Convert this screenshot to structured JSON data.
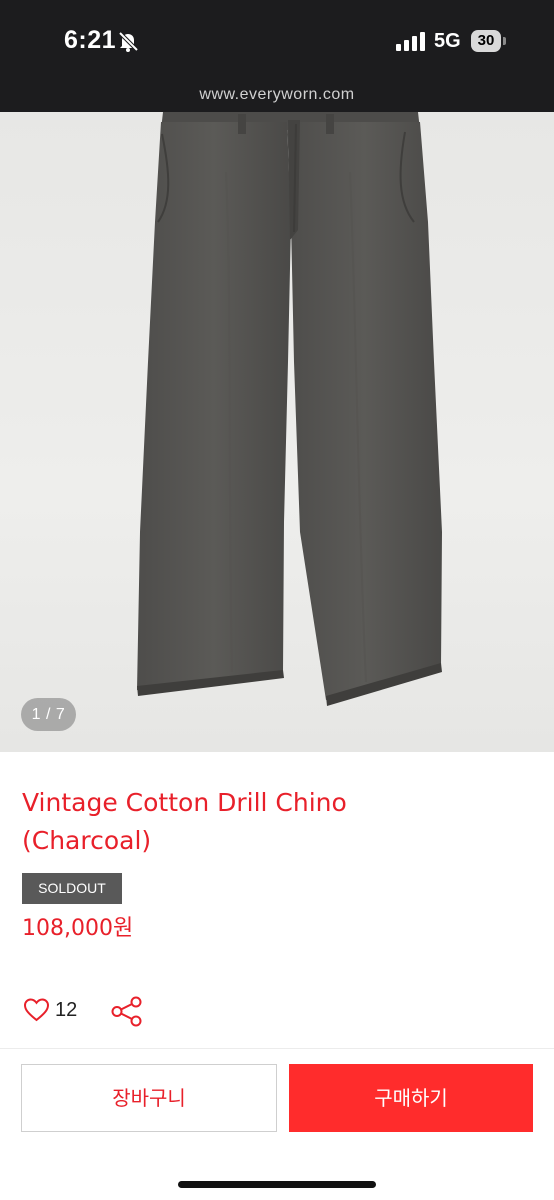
{
  "status_bar": {
    "time": "6:21",
    "network": "5G",
    "battery": "30"
  },
  "browser": {
    "url": "www.everyworn.com"
  },
  "gallery": {
    "counter": "1 / 7",
    "image_alt": "charcoal chino pants"
  },
  "product": {
    "title_line1": "Vintage Cotton Drill Chino",
    "title_line2": "(Charcoal)",
    "status_badge": "SOLDOUT",
    "price": "108,000원"
  },
  "social": {
    "like_count": "12"
  },
  "actions": {
    "cart_label": "장바구니",
    "buy_label": "구매하기"
  },
  "colors": {
    "accent": "#e8202a",
    "buy_button": "#ff2c2c",
    "badge": "#595959",
    "status_bar": "#1c1c1e"
  }
}
